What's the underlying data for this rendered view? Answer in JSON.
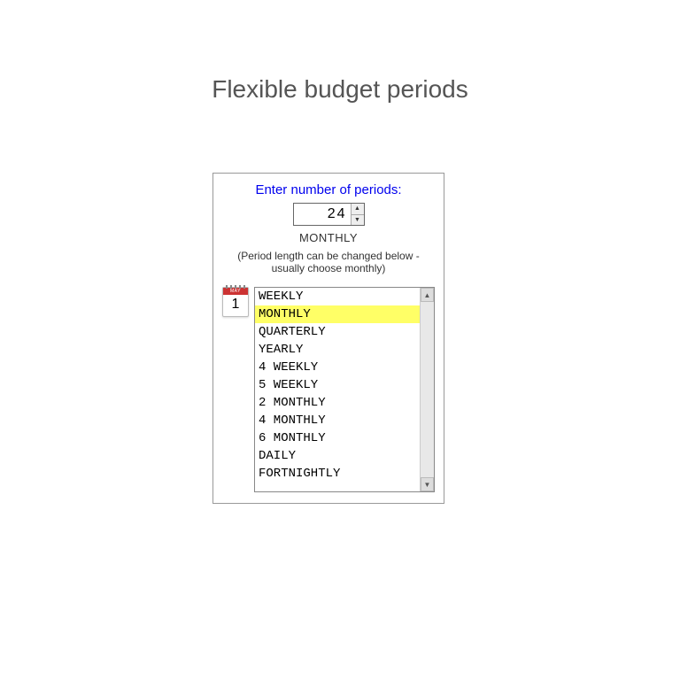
{
  "title": "Flexible budget periods",
  "panel": {
    "prompt": "Enter number of periods:",
    "periods_value": "24",
    "selected_period_label": "MONTHLY",
    "hint": "(Period length can be changed below - usually choose monthly)",
    "calendar": {
      "month": "MAY",
      "day": "1"
    },
    "period_options": [
      {
        "label": "WEEKLY",
        "selected": false
      },
      {
        "label": "MONTHLY",
        "selected": true
      },
      {
        "label": "QUARTERLY",
        "selected": false
      },
      {
        "label": "YEARLY",
        "selected": false
      },
      {
        "label": "4 WEEKLY",
        "selected": false
      },
      {
        "label": "5 WEEKLY",
        "selected": false
      },
      {
        "label": "2 MONTHLY",
        "selected": false
      },
      {
        "label": "4 MONTHLY",
        "selected": false
      },
      {
        "label": "6 MONTHLY",
        "selected": false
      },
      {
        "label": "DAILY",
        "selected": false
      },
      {
        "label": "FORTNIGHTLY",
        "selected": false
      }
    ]
  }
}
